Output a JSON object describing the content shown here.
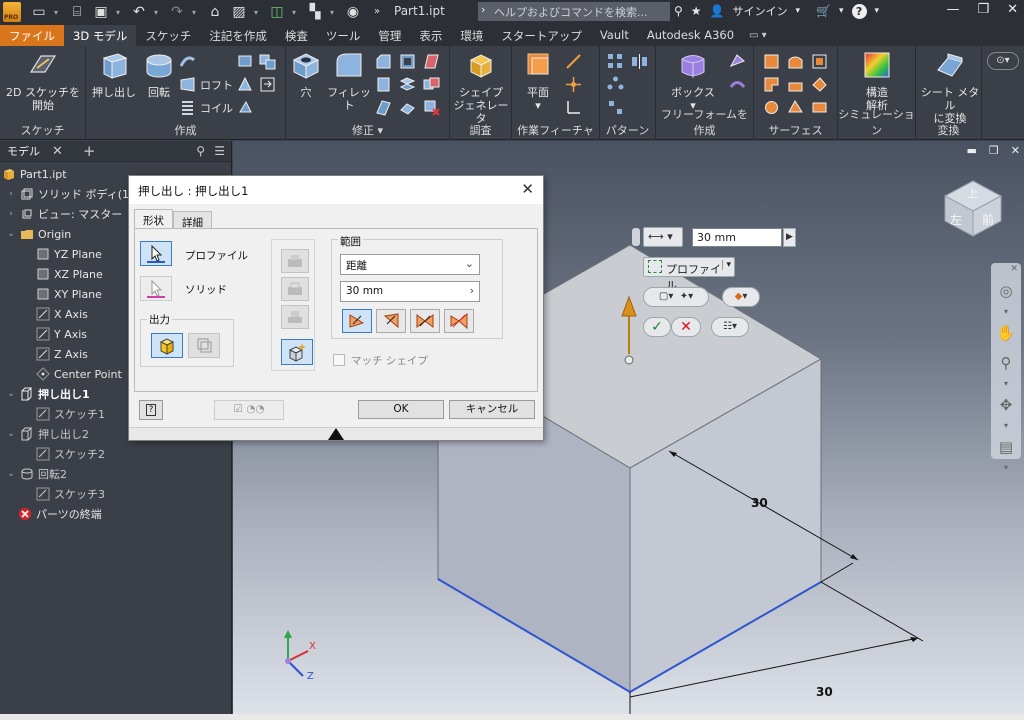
{
  "app": {
    "doc_title": "Part1.ipt",
    "help_placeholder": "ヘルプおよびコマンドを検索...",
    "signin": "サインイン",
    "app_badge": "PRO"
  },
  "ribbon_tabs": [
    "ファイル",
    "3D モデル",
    "スケッチ",
    "注記を作成",
    "検査",
    "ツール",
    "管理",
    "表示",
    "環境",
    "スタートアップ",
    "Vault",
    "Autodesk A360"
  ],
  "ribbon": {
    "sketch": {
      "btn_line1": "2D スケッチを",
      "btn_line2": "開始",
      "label": "スケッチ"
    },
    "create": {
      "extrude": "押し出し",
      "revolve": "回転",
      "loft": "ロフト",
      "coil": "コイル",
      "label": "作成"
    },
    "modify": {
      "hole": "穴",
      "fillet": "フィレット",
      "label": "修正"
    },
    "explore": {
      "btn_line1": "シェイプ",
      "btn_line2": "ジェネレータ",
      "label": "調査"
    },
    "work": {
      "plane": "平面",
      "label": "作業フィーチャ"
    },
    "pattern": {
      "label": "パターン"
    },
    "freeform": {
      "box": "ボックス",
      "label": "フリーフォームを作成"
    },
    "surface": {
      "label": "サーフェス"
    },
    "simulation": {
      "btn_line1": "構造",
      "btn_line2": "解析",
      "label": "シミュレーション"
    },
    "convert": {
      "btn_line1": "シート メタル",
      "btn_line2": "に変換",
      "label": "変換"
    }
  },
  "browser": {
    "tab": "モデル",
    "tree": [
      {
        "label": "Part1.ipt",
        "icon": "part-icon"
      },
      {
        "label": "ソリッド ボディ(1)",
        "icon": "solid-body-icon"
      },
      {
        "label": "ビュー: マスター",
        "icon": "view-icon"
      },
      {
        "label": "Origin",
        "icon": "folder-icon"
      },
      {
        "label": "YZ Plane",
        "icon": "plane-icon"
      },
      {
        "label": "XZ Plane",
        "icon": "plane-icon"
      },
      {
        "label": "XY Plane",
        "icon": "plane-icon"
      },
      {
        "label": "X Axis",
        "icon": "axis-icon"
      },
      {
        "label": "Y Axis",
        "icon": "axis-icon"
      },
      {
        "label": "Z Axis",
        "icon": "axis-icon"
      },
      {
        "label": "Center Point",
        "icon": "point-icon"
      },
      {
        "label": "押し出し1",
        "icon": "extrude-icon"
      },
      {
        "label": "スケッチ1",
        "icon": "sketch-icon"
      },
      {
        "label": "押し出し2",
        "icon": "extrude-icon"
      },
      {
        "label": "スケッチ2",
        "icon": "sketch-icon"
      },
      {
        "label": "回転2",
        "icon": "revolve-icon"
      },
      {
        "label": "スケッチ3",
        "icon": "sketch-icon"
      },
      {
        "label": "パーツの終端",
        "icon": "end-of-part-icon"
      }
    ]
  },
  "dialog": {
    "title": "押し出し : 押し出し1",
    "tab_shape": "形状",
    "tab_detail": "詳細",
    "profile": "プロファイル",
    "solid": "ソリッド",
    "output": "出力",
    "extents": "範囲",
    "extents_type": "距離",
    "distance": "30 mm",
    "match_shape": "マッチ シェイプ",
    "ok": "OK",
    "cancel": "キャンセル"
  },
  "minitoolbar": {
    "distance": "30 mm",
    "profile": "プロファイル"
  },
  "viewport": {
    "dim_a": "30",
    "dim_b": "30",
    "viewcube_top": "上",
    "viewcube_front": "前",
    "viewcube_left": "左",
    "triad_x": "X",
    "triad_y": "Y",
    "triad_z": "Z"
  }
}
